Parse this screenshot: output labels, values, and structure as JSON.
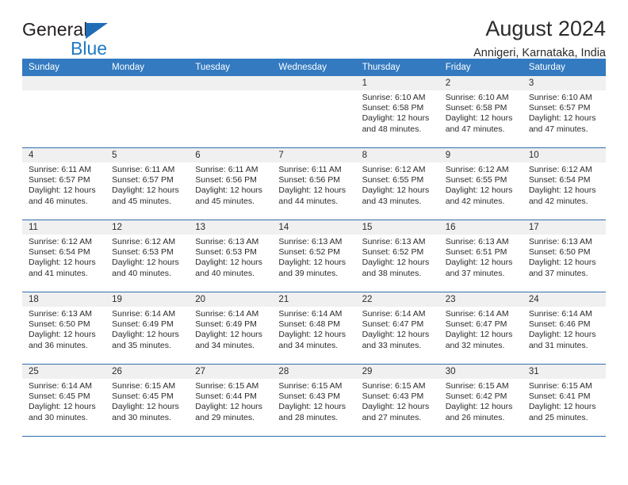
{
  "brand": {
    "name_part1": "General",
    "name_part2": "Blue",
    "flag_icon": "blue-triangle-flag-icon"
  },
  "header": {
    "title": "August 2024",
    "location": "Annigeri, Karnataka, India"
  },
  "theme": {
    "header_blue": "#337ac0",
    "rule_blue": "#2f6ead",
    "daynum_bg": "#f0f0f0",
    "brand_blue": "#1f7ac4",
    "text": "#2b2b2b"
  },
  "calendar": {
    "weekday_headers": [
      "Sunday",
      "Monday",
      "Tuesday",
      "Wednesday",
      "Thursday",
      "Friday",
      "Saturday"
    ],
    "weeks": [
      [
        {
          "day": "",
          "empty": true,
          "lines": []
        },
        {
          "day": "",
          "empty": true,
          "lines": []
        },
        {
          "day": "",
          "empty": true,
          "lines": []
        },
        {
          "day": "",
          "empty": true,
          "lines": []
        },
        {
          "day": "1",
          "lines": [
            "Sunrise: 6:10 AM",
            "Sunset: 6:58 PM",
            "Daylight: 12 hours",
            "and 48 minutes."
          ]
        },
        {
          "day": "2",
          "lines": [
            "Sunrise: 6:10 AM",
            "Sunset: 6:58 PM",
            "Daylight: 12 hours",
            "and 47 minutes."
          ]
        },
        {
          "day": "3",
          "lines": [
            "Sunrise: 6:10 AM",
            "Sunset: 6:57 PM",
            "Daylight: 12 hours",
            "and 47 minutes."
          ]
        }
      ],
      [
        {
          "day": "4",
          "lines": [
            "Sunrise: 6:11 AM",
            "Sunset: 6:57 PM",
            "Daylight: 12 hours",
            "and 46 minutes."
          ]
        },
        {
          "day": "5",
          "lines": [
            "Sunrise: 6:11 AM",
            "Sunset: 6:57 PM",
            "Daylight: 12 hours",
            "and 45 minutes."
          ]
        },
        {
          "day": "6",
          "lines": [
            "Sunrise: 6:11 AM",
            "Sunset: 6:56 PM",
            "Daylight: 12 hours",
            "and 45 minutes."
          ]
        },
        {
          "day": "7",
          "lines": [
            "Sunrise: 6:11 AM",
            "Sunset: 6:56 PM",
            "Daylight: 12 hours",
            "and 44 minutes."
          ]
        },
        {
          "day": "8",
          "lines": [
            "Sunrise: 6:12 AM",
            "Sunset: 6:55 PM",
            "Daylight: 12 hours",
            "and 43 minutes."
          ]
        },
        {
          "day": "9",
          "lines": [
            "Sunrise: 6:12 AM",
            "Sunset: 6:55 PM",
            "Daylight: 12 hours",
            "and 42 minutes."
          ]
        },
        {
          "day": "10",
          "lines": [
            "Sunrise: 6:12 AM",
            "Sunset: 6:54 PM",
            "Daylight: 12 hours",
            "and 42 minutes."
          ]
        }
      ],
      [
        {
          "day": "11",
          "lines": [
            "Sunrise: 6:12 AM",
            "Sunset: 6:54 PM",
            "Daylight: 12 hours",
            "and 41 minutes."
          ]
        },
        {
          "day": "12",
          "lines": [
            "Sunrise: 6:12 AM",
            "Sunset: 6:53 PM",
            "Daylight: 12 hours",
            "and 40 minutes."
          ]
        },
        {
          "day": "13",
          "lines": [
            "Sunrise: 6:13 AM",
            "Sunset: 6:53 PM",
            "Daylight: 12 hours",
            "and 40 minutes."
          ]
        },
        {
          "day": "14",
          "lines": [
            "Sunrise: 6:13 AM",
            "Sunset: 6:52 PM",
            "Daylight: 12 hours",
            "and 39 minutes."
          ]
        },
        {
          "day": "15",
          "lines": [
            "Sunrise: 6:13 AM",
            "Sunset: 6:52 PM",
            "Daylight: 12 hours",
            "and 38 minutes."
          ]
        },
        {
          "day": "16",
          "lines": [
            "Sunrise: 6:13 AM",
            "Sunset: 6:51 PM",
            "Daylight: 12 hours",
            "and 37 minutes."
          ]
        },
        {
          "day": "17",
          "lines": [
            "Sunrise: 6:13 AM",
            "Sunset: 6:50 PM",
            "Daylight: 12 hours",
            "and 37 minutes."
          ]
        }
      ],
      [
        {
          "day": "18",
          "lines": [
            "Sunrise: 6:13 AM",
            "Sunset: 6:50 PM",
            "Daylight: 12 hours",
            "and 36 minutes."
          ]
        },
        {
          "day": "19",
          "lines": [
            "Sunrise: 6:14 AM",
            "Sunset: 6:49 PM",
            "Daylight: 12 hours",
            "and 35 minutes."
          ]
        },
        {
          "day": "20",
          "lines": [
            "Sunrise: 6:14 AM",
            "Sunset: 6:49 PM",
            "Daylight: 12 hours",
            "and 34 minutes."
          ]
        },
        {
          "day": "21",
          "lines": [
            "Sunrise: 6:14 AM",
            "Sunset: 6:48 PM",
            "Daylight: 12 hours",
            "and 34 minutes."
          ]
        },
        {
          "day": "22",
          "lines": [
            "Sunrise: 6:14 AM",
            "Sunset: 6:47 PM",
            "Daylight: 12 hours",
            "and 33 minutes."
          ]
        },
        {
          "day": "23",
          "lines": [
            "Sunrise: 6:14 AM",
            "Sunset: 6:47 PM",
            "Daylight: 12 hours",
            "and 32 minutes."
          ]
        },
        {
          "day": "24",
          "lines": [
            "Sunrise: 6:14 AM",
            "Sunset: 6:46 PM",
            "Daylight: 12 hours",
            "and 31 minutes."
          ]
        }
      ],
      [
        {
          "day": "25",
          "lines": [
            "Sunrise: 6:14 AM",
            "Sunset: 6:45 PM",
            "Daylight: 12 hours",
            "and 30 minutes."
          ]
        },
        {
          "day": "26",
          "lines": [
            "Sunrise: 6:15 AM",
            "Sunset: 6:45 PM",
            "Daylight: 12 hours",
            "and 30 minutes."
          ]
        },
        {
          "day": "27",
          "lines": [
            "Sunrise: 6:15 AM",
            "Sunset: 6:44 PM",
            "Daylight: 12 hours",
            "and 29 minutes."
          ]
        },
        {
          "day": "28",
          "lines": [
            "Sunrise: 6:15 AM",
            "Sunset: 6:43 PM",
            "Daylight: 12 hours",
            "and 28 minutes."
          ]
        },
        {
          "day": "29",
          "lines": [
            "Sunrise: 6:15 AM",
            "Sunset: 6:43 PM",
            "Daylight: 12 hours",
            "and 27 minutes."
          ]
        },
        {
          "day": "30",
          "lines": [
            "Sunrise: 6:15 AM",
            "Sunset: 6:42 PM",
            "Daylight: 12 hours",
            "and 26 minutes."
          ]
        },
        {
          "day": "31",
          "lines": [
            "Sunrise: 6:15 AM",
            "Sunset: 6:41 PM",
            "Daylight: 12 hours",
            "and 25 minutes."
          ]
        }
      ]
    ]
  }
}
